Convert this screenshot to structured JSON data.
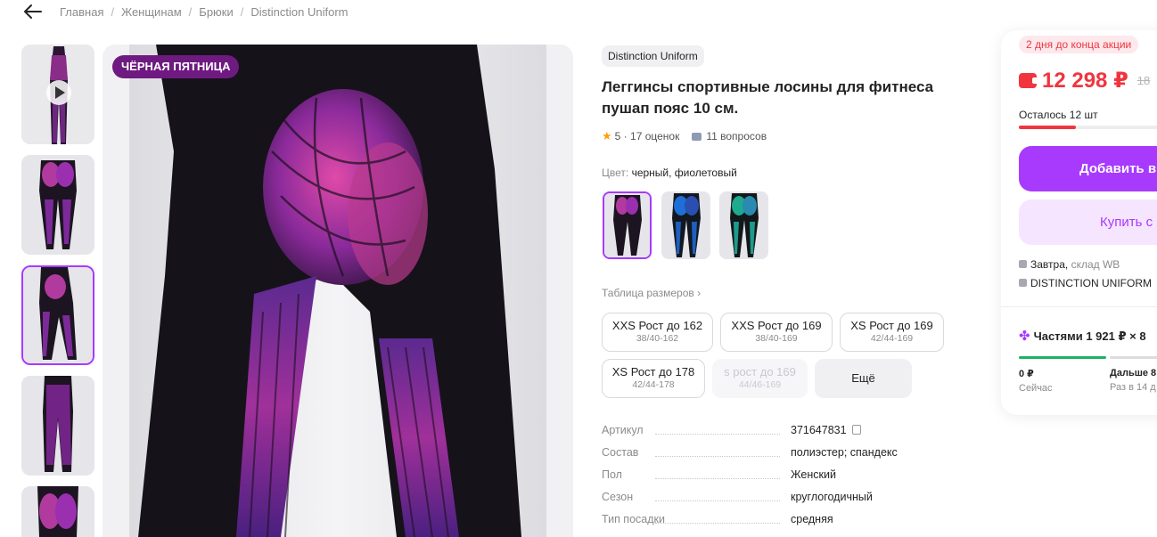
{
  "breadcrumb": [
    "Главная",
    "Женщинам",
    "Брюки",
    "Distinction Uniform"
  ],
  "gallery": {
    "thumbnails": [
      {
        "name": "thumb-video",
        "has_play": true
      },
      {
        "name": "thumb-back-view"
      },
      {
        "name": "thumb-side-view",
        "selected": true
      },
      {
        "name": "thumb-back-full"
      },
      {
        "name": "thumb-partial"
      }
    ],
    "promo_badge": "ЧЁРНАЯ ПЯТНИЦА"
  },
  "product": {
    "brand": "Distinction Uniform",
    "title": "Леггинсы спортивные лосины для фитнеса пушап пояс 10 см.",
    "rating": "5",
    "reviews": "17 оценок",
    "questions": "11 вопросов",
    "color_label": "Цвет:",
    "color_value": "черный, фиолетовый",
    "colors": [
      "#8a2be2",
      "#1e6fd8",
      "#1fa98f"
    ],
    "size_table_link": "Таблица размеров",
    "sizes": [
      {
        "main": "XXS Рост до 162",
        "sub": "38/40-162",
        "available": true
      },
      {
        "main": "XXS Рост до 169",
        "sub": "38/40-169",
        "available": true
      },
      {
        "main": "XS Рост до 169",
        "sub": "42/44-169",
        "available": true
      },
      {
        "main": "XS Рост до 178",
        "sub": "42/44-178",
        "available": true
      },
      {
        "main": "s рост до 169",
        "sub": "44/46-169",
        "available": false
      }
    ],
    "more_sizes": "Ещё",
    "specs": [
      {
        "key": "Артикул",
        "value": "371647831"
      },
      {
        "key": "Состав",
        "value": "полиэстер; спандекс"
      },
      {
        "key": "Пол",
        "value": "Женский"
      },
      {
        "key": "Сезон",
        "value": "круглогодичный"
      },
      {
        "key": "Тип посадки",
        "value": "средняя"
      }
    ]
  },
  "buy": {
    "deadline": "2 дня до конца акции",
    "price": "12 298 ₽",
    "old_price": "18 ",
    "stock": "Осталось 12 шт",
    "stock_fraction": 0.32,
    "add_to_cart": "Добавить в",
    "buy_now": "Купить с",
    "delivery_when": "Завтра,",
    "delivery_where": "склад WB",
    "seller": "DISTINCTION UNIFORM",
    "installment": "Частями 1 921 ₽ × 8",
    "installment_now_value": "0 ₽",
    "installment_now_label": "Сейчас",
    "installment_next_value": "Дальше 8",
    "installment_next_label": "Раз в 14 д"
  },
  "colors": {
    "accent": "#a73afd",
    "price": "#f0353f",
    "promo": "#6e1a80"
  }
}
